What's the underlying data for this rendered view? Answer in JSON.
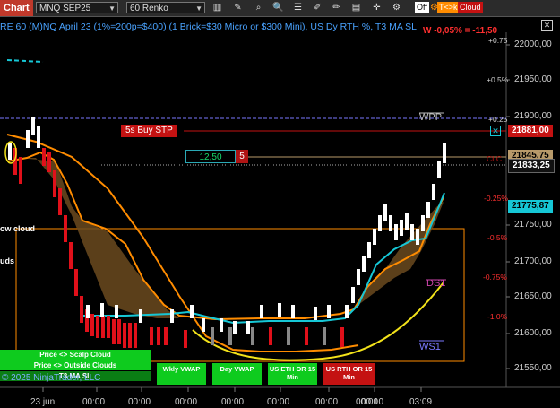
{
  "toolbar": {
    "chart_tab": "Chart",
    "instrument": "MNQ SEP25",
    "bar_type": "60 Renko",
    "toggle_off": "Off",
    "toggle_tick": "T<>k",
    "toggle_cloud": "Cloud"
  },
  "header": {
    "title": "RE 60 (M)NQ April 23 (1%=200p=$400) (1 Brick=$30 Micro or $300 Mini), US Dy RTH %, T3 MA SL",
    "pnl": "W -0,05% = -11,50"
  },
  "price_axis": {
    "ticks": [
      "22000,00",
      "21950,00",
      "21900,00",
      "21750,00",
      "21700,00",
      "21650,00",
      "21600,00",
      "21550,00"
    ],
    "badges": [
      {
        "label": "21881,00",
        "bg": "#c41212",
        "fg": "#ffffff"
      },
      {
        "label": "21845,75",
        "bg": "#b89a6a",
        "fg": "#000000"
      },
      {
        "label": "21833,25",
        "bg": "#111111",
        "fg": "#ffffff"
      },
      {
        "label": "21775,87",
        "bg": "#16c7d6",
        "fg": "#000000"
      }
    ]
  },
  "pct_labels": [
    "+0.75",
    "+0.5%",
    "+0.25",
    "-0.25%",
    "-0.5%",
    "-0.75%",
    "-1.0%"
  ],
  "levels": {
    "wpp": "WPP",
    "ds1": "DS1",
    "ws1": "WS1",
    "clc": "CLC"
  },
  "orders": {
    "buy_stop": "5s Buy STP",
    "price": "12,50",
    "qty": "5"
  },
  "left_labels": {
    "cloud": "ow cloud",
    "clouds": "uds"
  },
  "buttons": {
    "scalp_cloud": "Price <> Scalp Cloud",
    "outside_clouds": "Price <> Outside Clouds",
    "t3_ma_sl": "T3 MA SL",
    "wkly_vwap": "Wkly VWAP",
    "day_vwap": "Day VWAP",
    "us_eth": "US ETH OR 15 Min",
    "us_rth": "US RTH OR 15 Min"
  },
  "copyright": "© 2025 NinjaTrader, LLC",
  "x_axis": [
    "23 jun",
    "00:00",
    "00:00",
    "00:00",
    "00:00",
    "00:00",
    "00:00",
    "00:00",
    "00:10",
    "03:09"
  ],
  "colors": {
    "up": "#ffffff",
    "down": "#e0101a",
    "cloud": "#16c7d6",
    "orange": "#ff8c00",
    "yellow": "#f2e21a"
  }
}
